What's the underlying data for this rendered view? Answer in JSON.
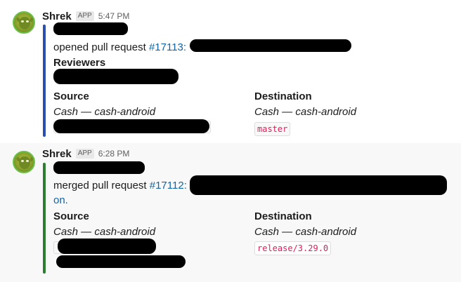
{
  "messages": [
    {
      "sender": "Shrek",
      "badge": "APP",
      "time": "5:47 PM",
      "action_text": "opened pull request ",
      "pr_number": "#17113:",
      "reviewers_label": "Reviewers",
      "source_label": "Source",
      "source_repo": "Cash — cash-android",
      "destination_label": "Destination",
      "destination_repo": "Cash — cash-android",
      "destination_branch": "master",
      "bar_color": "#2a4fae"
    },
    {
      "sender": "Shrek",
      "badge": "APP",
      "time": "6:28 PM",
      "action_text": "merged pull request ",
      "pr_number": "#17112:",
      "title_tail": "on.",
      "source_label": "Source",
      "source_repo": "Cash — cash-android",
      "destination_label": "Destination",
      "destination_repo": "Cash — cash-android",
      "destination_branch": "release/3.29.0",
      "bar_color": "#2e7d32"
    }
  ],
  "icons": {
    "avatar": "shrek-avatar-icon"
  },
  "colors": {
    "link": "#1264a3",
    "code_text": "#e01e5a",
    "muted": "#616061"
  }
}
